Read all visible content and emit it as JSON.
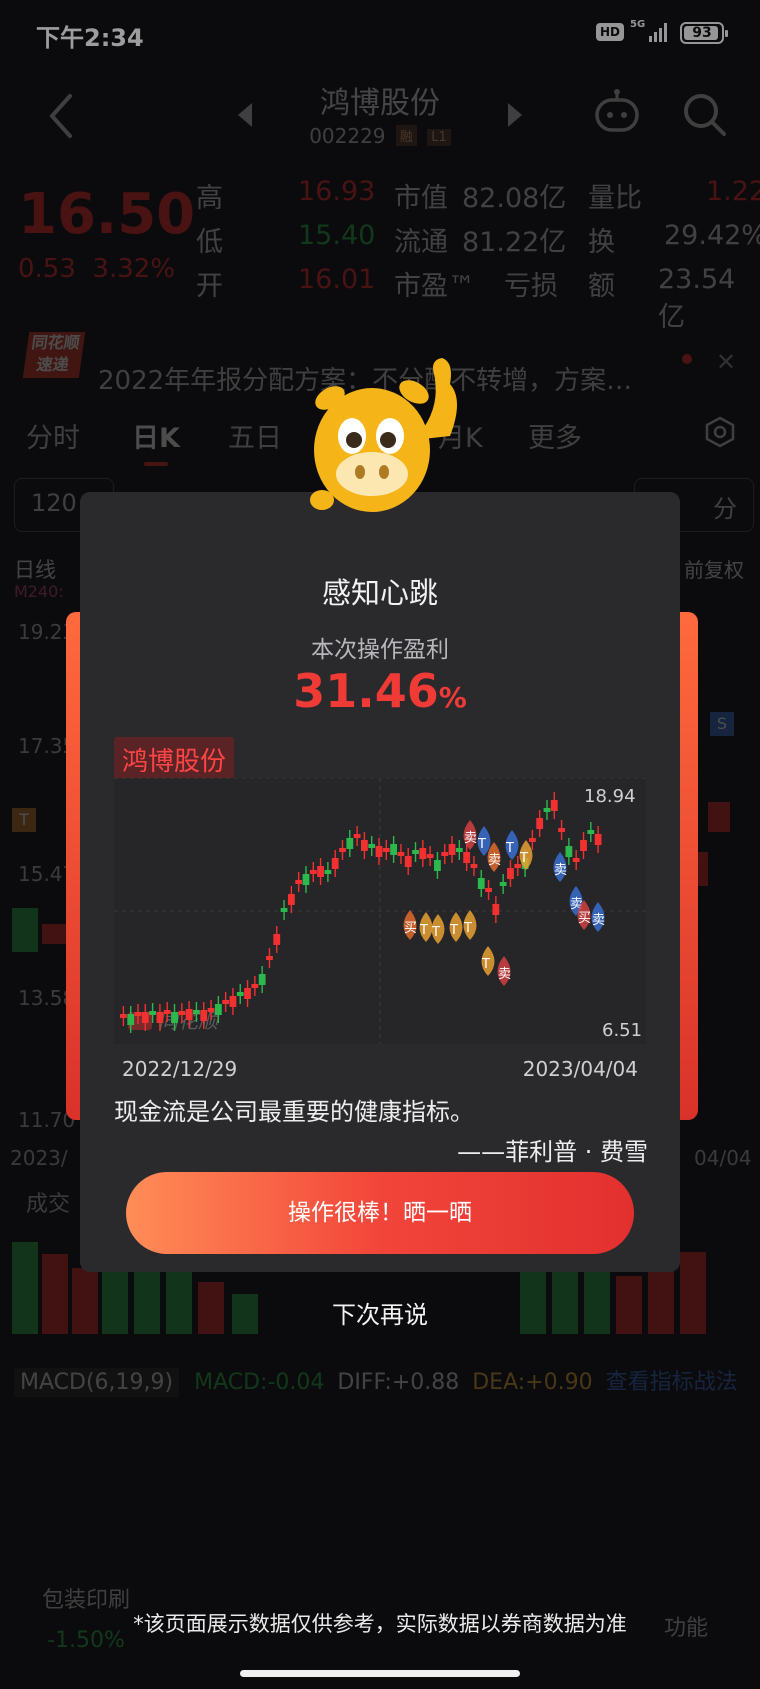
{
  "status_bar": {
    "time": "下午2:34",
    "hd": "HD",
    "network": "5G",
    "battery": "93"
  },
  "header": {
    "stock_name": "鸿博股份",
    "stock_code": "002229",
    "tag_margin": "融",
    "tag_level": "L1"
  },
  "quote": {
    "price": "16.50",
    "change": "0.53",
    "change_pct": "3.32%",
    "high_label": "高",
    "high": "16.93",
    "low_label": "低",
    "low": "15.40",
    "open_label": "开",
    "open": "16.01",
    "mcap_label": "市值",
    "mcap": "82.08亿",
    "float_label": "流通",
    "float": "81.22亿",
    "pe_label": "市盈™",
    "pe": "亏损",
    "vol_ratio_label": "量比",
    "vol_ratio": "1.22",
    "turnover_label": "换",
    "turnover": "29.42%",
    "amount_label": "额",
    "amount": "23.54亿"
  },
  "news": {
    "logo": "同花顺 速递",
    "text": "2022年年报分配方案：不分配不转增，方案…"
  },
  "tabs": [
    "分时",
    "日K",
    "五日",
    "月K",
    "更多"
  ],
  "periods": [
    "120",
    "分"
  ],
  "chart_bg": {
    "line_label": "日线",
    "ma_label": "M240:",
    "adj_label": "前复权",
    "y_labels": [
      "19.23",
      "17.35",
      "15.47",
      "13.58",
      "11.70"
    ],
    "date_left": "2023/",
    "date_right": "04/04",
    "volume_label": "成交",
    "t_marker": "T",
    "s_marker": "S"
  },
  "macd": {
    "name": "MACD(6,19,9)",
    "macd": "MACD:-0.04",
    "diff": "DIFF:+0.88",
    "dea": "DEA:+0.90",
    "link": "查看指标战法"
  },
  "bottom_nav": {
    "left_name": "包装印刷",
    "left_pct": "-1.50%",
    "right": "功能"
  },
  "modal": {
    "title": "感知心跳",
    "subtitle": "本次操作盈利",
    "profit": "31.46",
    "profit_unit": "%",
    "stock_name": "鸿博股份",
    "chart_high": "18.94",
    "chart_low": "6.51",
    "watermark": "同花顺",
    "date_start": "2022/12/29",
    "date_end": "2023/04/04",
    "quote": "现金流是公司最重要的健康指标。",
    "author": "——菲利普 · 费雪",
    "buy_label": "买",
    "sell_label": "卖",
    "t_label": "T",
    "cta": "操作很棒！晒一晒",
    "later": "下次再说"
  },
  "disclaimer": "*该页面展示数据仅供参考，实际数据以券商数据为准",
  "colors": {
    "up": "#f23030",
    "down": "#2db84d",
    "accent": "#f03a35"
  }
}
